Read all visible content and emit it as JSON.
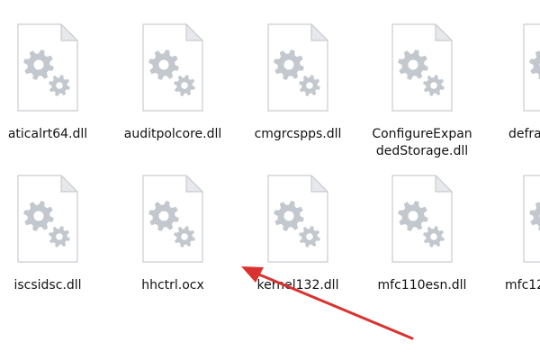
{
  "files": [
    {
      "name": "aticalrt64.dll",
      "icon": "dll-gear-icon"
    },
    {
      "name": "auditpolcore.dll",
      "icon": "dll-gear-icon"
    },
    {
      "name": "cmgrcspps.dll",
      "icon": "dll-gear-icon"
    },
    {
      "name": "ConfigureExpan\ndedStorage.dll",
      "icon": "dll-gear-icon"
    },
    {
      "name": "defra",
      "icon": "dll-gear-icon"
    },
    {
      "name": "iscsidsc.dll",
      "icon": "dll-gear-icon"
    },
    {
      "name": "hhctrl.ocx",
      "icon": "dll-gear-icon"
    },
    {
      "name": "kernel132.dll",
      "icon": "dll-gear-icon"
    },
    {
      "name": "mfc110esn.dll",
      "icon": "dll-gear-icon"
    },
    {
      "name": "mfc12",
      "icon": "dll-gear-icon"
    }
  ],
  "colors": {
    "page_fill": "#ffffff",
    "page_stroke": "#c9ccd0",
    "fold_fill": "#e6e8eb",
    "gear": "#c3c8ce",
    "annotation_arrow": "#d9322f"
  }
}
